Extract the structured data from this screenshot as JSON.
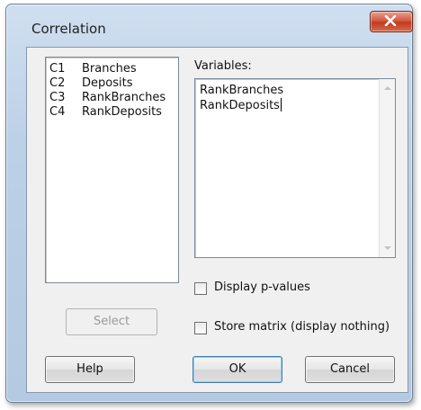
{
  "dialog": {
    "title": "Correlation",
    "close_icon": "close-icon"
  },
  "columns": [
    {
      "id": "C1",
      "name": "Branches"
    },
    {
      "id": "C2",
      "name": "Deposits"
    },
    {
      "id": "C3",
      "name": "RankBranches"
    },
    {
      "id": "C4",
      "name": "RankDeposits"
    }
  ],
  "variables": {
    "label": "Variables:",
    "lines": [
      "RankBranches",
      "RankDeposits"
    ]
  },
  "options": {
    "display_pvalues": {
      "label": "Display p-values",
      "checked": false
    },
    "store_matrix": {
      "label": "Store matrix (display nothing)",
      "checked": false
    }
  },
  "buttons": {
    "select": "Select",
    "help": "Help",
    "ok": "OK",
    "cancel": "Cancel"
  }
}
